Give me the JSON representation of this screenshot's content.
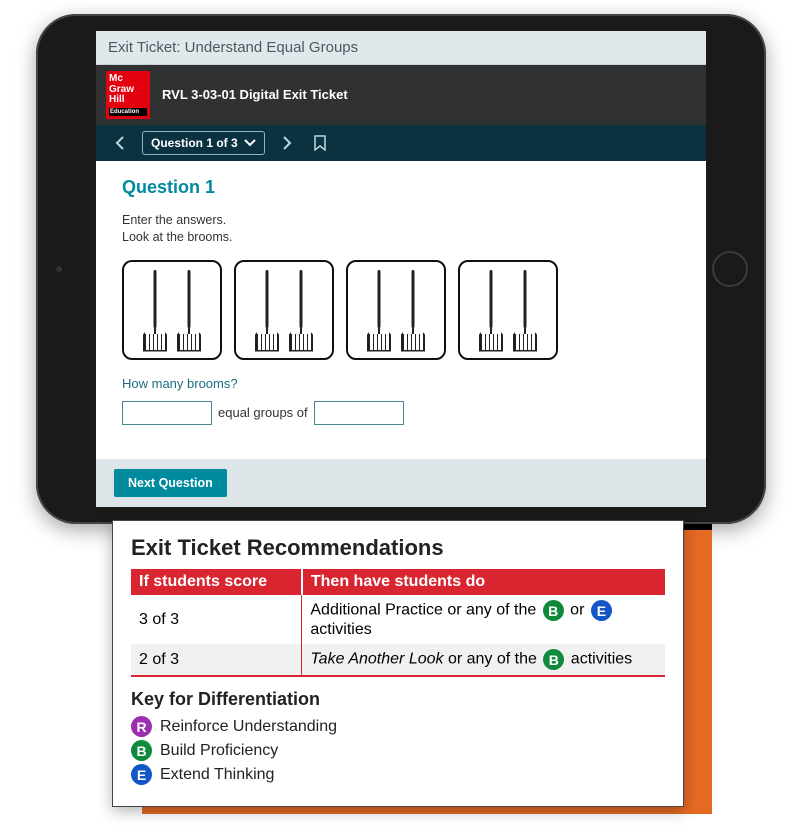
{
  "titlebar": "Exit Ticket: Understand Equal Groups",
  "header": {
    "logo": {
      "line1": "Mc",
      "line2": "Graw",
      "line3": "Hill",
      "edu": "Education"
    },
    "lesson": "RVL 3-03-01 Digital Exit Ticket"
  },
  "nav": {
    "question_select": "Question 1 of 3"
  },
  "question": {
    "title": "Question 1",
    "instr1": "Enter the answers.",
    "instr2": "Look at the brooms.",
    "prompt": "How many brooms?",
    "fill_mid": "equal groups of",
    "groups": 4,
    "brooms_per_group": 2,
    "blank1": "",
    "blank2": ""
  },
  "footer": {
    "next": "Next Question"
  },
  "reco": {
    "title": "Exit Ticket Recommendations",
    "th1": "If students score",
    "th2": "Then have students do",
    "rows": [
      {
        "score": "3 of 3",
        "text_a": "Additional Practice or any of the ",
        "badge1": "B",
        "mid": " or ",
        "badge2": "E",
        "text_b": " activities"
      },
      {
        "score": "2 of 3",
        "em": "Take Another Look",
        "text_a": " or any of the ",
        "badge1": "B",
        "text_b": " activities"
      }
    ],
    "key_title": "Key for Differentiation",
    "keys": [
      {
        "letter": "R",
        "label": "Reinforce Understanding"
      },
      {
        "letter": "B",
        "label": "Build Proficiency"
      },
      {
        "letter": "E",
        "label": "Extend Thinking"
      }
    ]
  }
}
